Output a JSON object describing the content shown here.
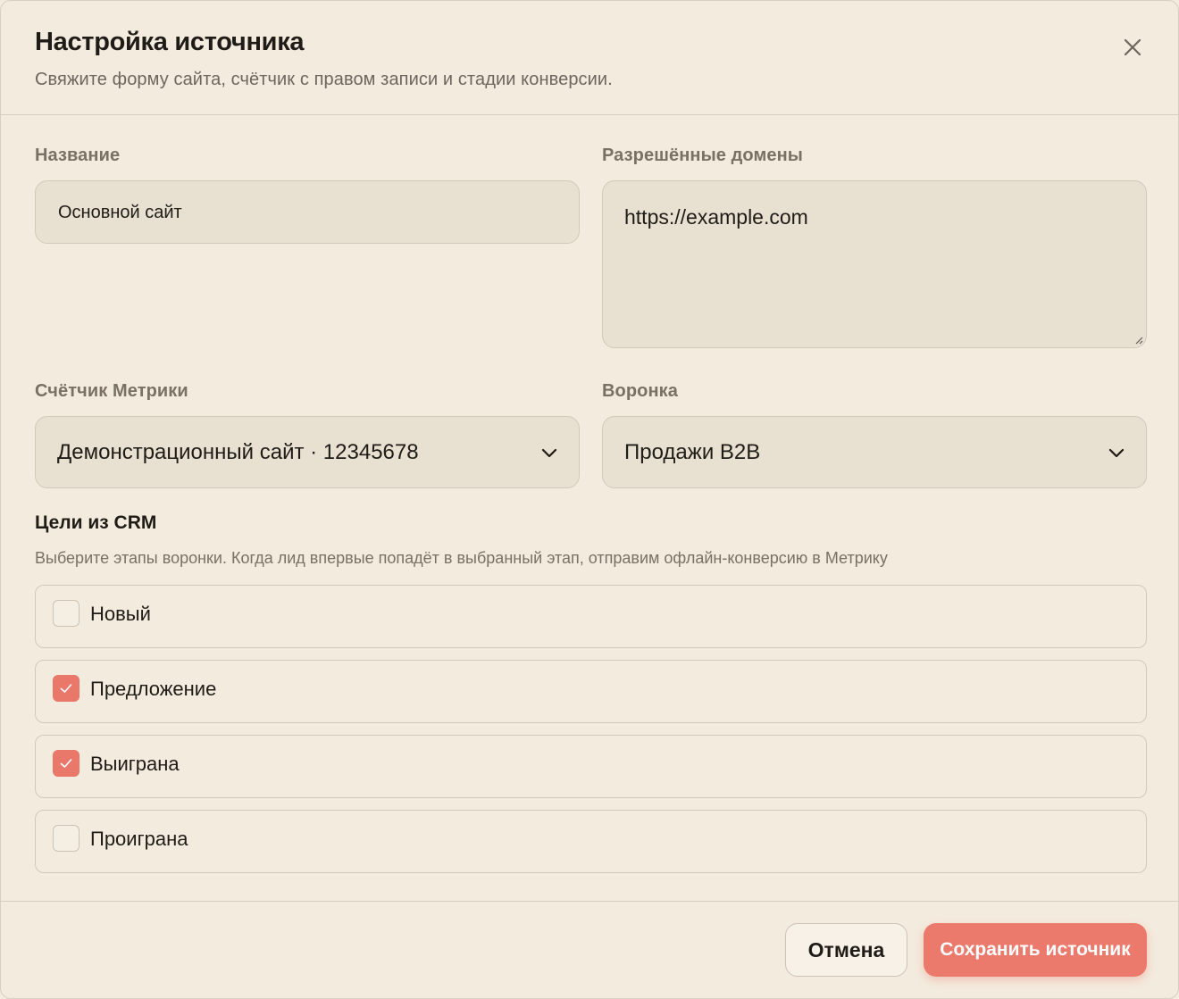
{
  "dialog": {
    "title": "Настройка источника",
    "subtitle": "Свяжите форму сайта, счётчик с правом записи и стадии конверсии."
  },
  "form": {
    "name": {
      "label": "Название",
      "value": "Основной сайт"
    },
    "domains": {
      "label": "Разрешённые домены",
      "value": "https://example.com"
    },
    "counter": {
      "label": "Счётчик Метрики",
      "value": "Демонстрационный сайт · 12345678"
    },
    "funnel": {
      "label": "Воронка",
      "value": "Продажи B2B"
    }
  },
  "goals": {
    "title": "Цели из CRM",
    "hint": "Выберите этапы воронки. Когда лид впервые попадёт в выбранный этап, отправим офлайн-конверсию в Метрику",
    "stages": [
      {
        "label": "Новый",
        "checked": false
      },
      {
        "label": "Предложение",
        "checked": true
      },
      {
        "label": "Выиграна",
        "checked": true
      },
      {
        "label": "Проиграна",
        "checked": false
      }
    ]
  },
  "footer": {
    "cancel_label": "Отмена",
    "save_label": "Сохранить источник"
  },
  "colors": {
    "background": "#f3ebde",
    "input_bg": "#e8e0d1",
    "accent": "#ec7a6c",
    "checkbox_checked": "#e9786b"
  },
  "icons": {
    "close": "close-icon",
    "select_arrow": "chevron-down-icon",
    "checkmark": "check-icon"
  }
}
